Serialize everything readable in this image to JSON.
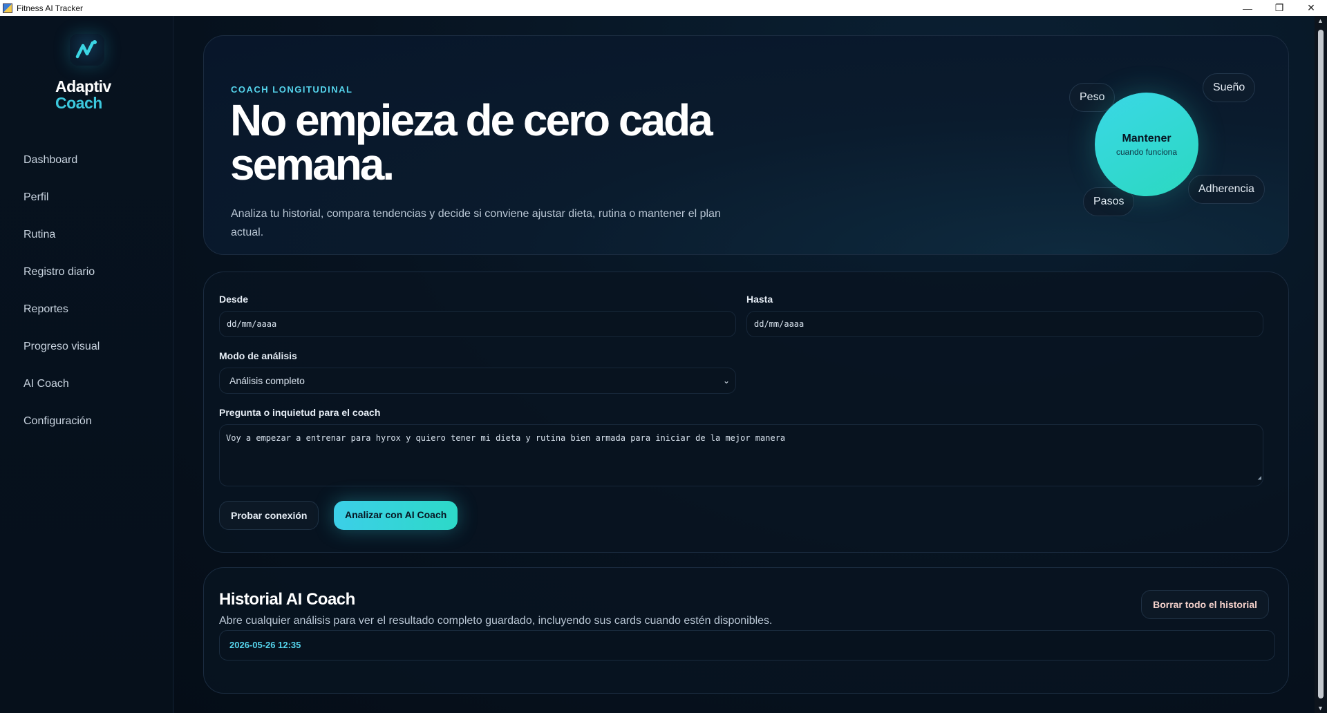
{
  "window": {
    "title": "Fitness AI Tracker",
    "minimize": "—",
    "restore": "❐",
    "close": "✕"
  },
  "brand": {
    "line1": "Adaptiv",
    "line2": "Coach",
    "accent": "#3cc8dd",
    "icon": "wave-logo-icon"
  },
  "sidebar": {
    "items": [
      {
        "label": "Dashboard"
      },
      {
        "label": "Perfil"
      },
      {
        "label": "Rutina"
      },
      {
        "label": "Registro diario"
      },
      {
        "label": "Reportes"
      },
      {
        "label": "Progreso visual"
      },
      {
        "label": "AI Coach"
      },
      {
        "label": "Configuración"
      }
    ]
  },
  "hero": {
    "eyebrow": "COACH LONGITUDINAL",
    "title": "No empieza de cero cada semana.",
    "description": "Analiza tu historial, compara tendencias y decide si conviene ajustar dieta, rutina o mantener el plan actual.",
    "bubble_title": "Mantener",
    "bubble_subtitle": "cuando funciona",
    "chips": [
      "Peso",
      "Sueño",
      "Adherencia",
      "Pasos"
    ]
  },
  "form": {
    "from_label": "Desde",
    "from_placeholder": "dd/mm/aaaa",
    "to_label": "Hasta",
    "to_placeholder": "dd/mm/aaaa",
    "mode_label": "Modo de análisis",
    "mode_value": "Análisis completo",
    "question_label": "Pregunta o inquietud para el coach",
    "question_value": "Voy a empezar a entrenar para hyrox y quiero tener mi dieta y rutina bien armada para iniciar de la mejor manera",
    "test_button": "Probar conexión",
    "analyze_button": "Analizar con AI Coach"
  },
  "history": {
    "title": "Historial AI Coach",
    "description": "Abre cualquier análisis para ver el resultado completo guardado, incluyendo sus cards cuando estén disponibles.",
    "clear_button": "Borrar todo el historial",
    "entries": [
      {
        "timestamp": "2026-05-26 12:35"
      }
    ]
  }
}
